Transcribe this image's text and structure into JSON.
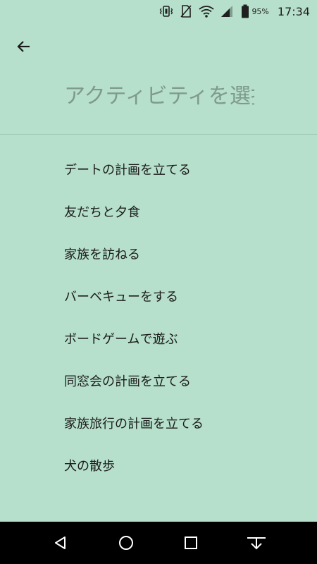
{
  "status_bar": {
    "icons": [
      "vibrate-icon",
      "no-sim-icon",
      "wifi-icon",
      "signal-icon",
      "battery-icon"
    ],
    "battery_percent": "95%",
    "time": "17:34"
  },
  "header": {
    "back_icon": "arrow-left-icon",
    "search_placeholder": "アクティビティを選択",
    "search_value": ""
  },
  "activities": [
    {
      "label": "デートの計画を立てる"
    },
    {
      "label": "友だちと夕食"
    },
    {
      "label": "家族を訪ねる"
    },
    {
      "label": "バーベキューをする"
    },
    {
      "label": "ボードゲームで遊ぶ"
    },
    {
      "label": "同窓会の計画を立てる"
    },
    {
      "label": "家族旅行の計画を立てる"
    },
    {
      "label": "犬の散歩"
    }
  ],
  "navigation_bar": {
    "buttons": [
      "back-triangle-icon",
      "home-circle-icon",
      "recents-square-icon",
      "hide-keyboard-icon"
    ]
  },
  "colors": {
    "background": "#b6e0cb",
    "nav_bar": "#000000",
    "text": "#1b1b1b",
    "placeholder": "#7f9a8c"
  }
}
